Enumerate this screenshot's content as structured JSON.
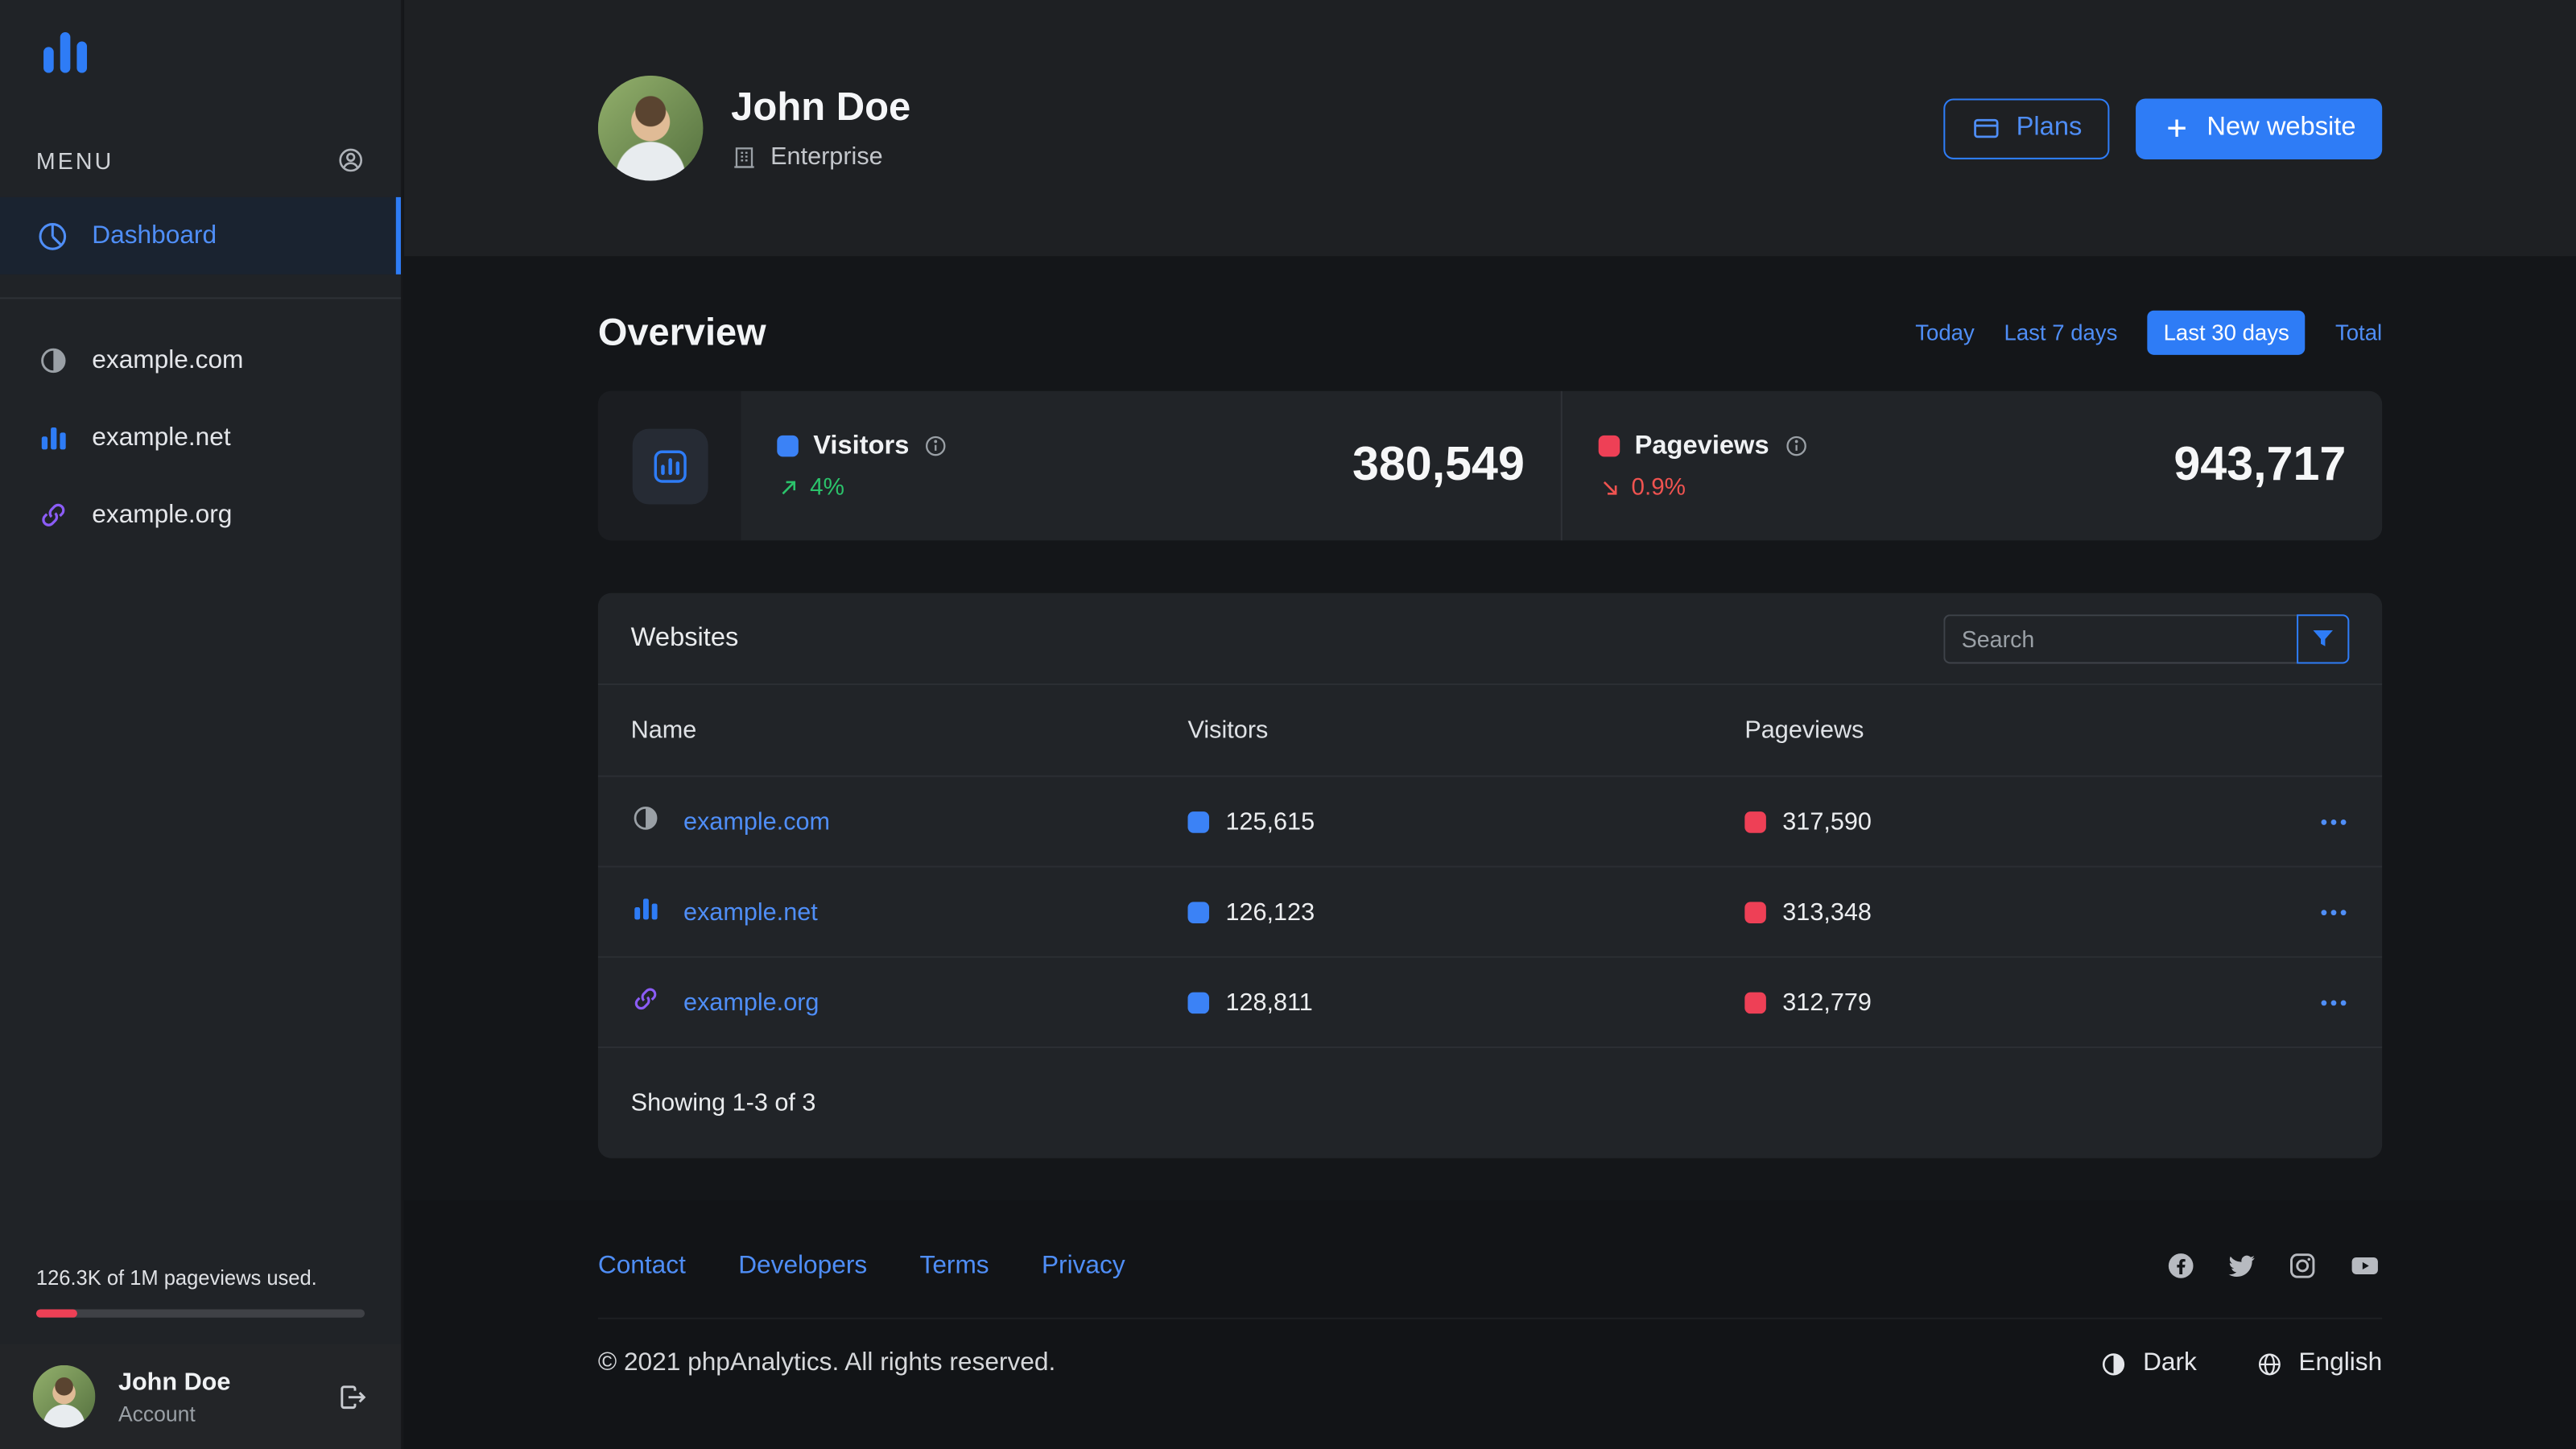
{
  "sidebar": {
    "menu_label": "MENU",
    "items": [
      {
        "label": "Dashboard",
        "icon": "pie-chart-icon",
        "active": true
      }
    ],
    "websites": [
      {
        "label": "example.com",
        "icon": "contrast-icon"
      },
      {
        "label": "example.net",
        "icon": "bar-chart-icon"
      },
      {
        "label": "example.org",
        "icon": "link-icon"
      }
    ],
    "usage": {
      "text": "126.3K of 1M pageviews used.",
      "percent": "12.6%"
    },
    "user": {
      "name": "John Doe",
      "role": "Account"
    }
  },
  "header": {
    "name": "John Doe",
    "plan": "Enterprise",
    "plans_button": "Plans",
    "new_website_button": "New website"
  },
  "overview": {
    "title": "Overview",
    "filters": [
      {
        "label": "Today",
        "active": false
      },
      {
        "label": "Last 7 days",
        "active": false
      },
      {
        "label": "Last 30 days",
        "active": true
      },
      {
        "label": "Total",
        "active": false
      }
    ],
    "stats": [
      {
        "label": "Visitors",
        "delta": "4%",
        "trend": "up",
        "value": "380,549",
        "swatch_color": "#3b82f6"
      },
      {
        "label": "Pageviews",
        "delta": "0.9%",
        "trend": "down",
        "value": "943,717",
        "swatch_color": "#ee4056"
      }
    ]
  },
  "websites_card": {
    "title": "Websites",
    "search_placeholder": "Search",
    "columns": [
      "Name",
      "Visitors",
      "Pageviews"
    ],
    "rows": [
      {
        "name": "example.com",
        "icon": "contrast-icon",
        "visitors": "125,615",
        "pageviews": "317,590"
      },
      {
        "name": "example.net",
        "icon": "bar-chart-icon",
        "visitors": "126,123",
        "pageviews": "313,348"
      },
      {
        "name": "example.org",
        "icon": "link-icon",
        "visitors": "128,811",
        "pageviews": "312,779"
      }
    ],
    "footer": "Showing 1-3 of 3"
  },
  "footer": {
    "links": [
      "Contact",
      "Developers",
      "Terms",
      "Privacy"
    ],
    "social": [
      "facebook",
      "twitter",
      "instagram",
      "youtube"
    ],
    "copyright": "© 2021 phpAnalytics. All rights reserved.",
    "theme_label": "Dark",
    "language_label": "English"
  },
  "colors": {
    "accent": "#2e7cf6",
    "link": "#4f8ef7",
    "visitors_swatch": "#3b82f6",
    "pageviews_swatch": "#ee4056",
    "positive": "#2bc36b",
    "negative": "#ef5350",
    "purple": "#8b5cf6"
  }
}
